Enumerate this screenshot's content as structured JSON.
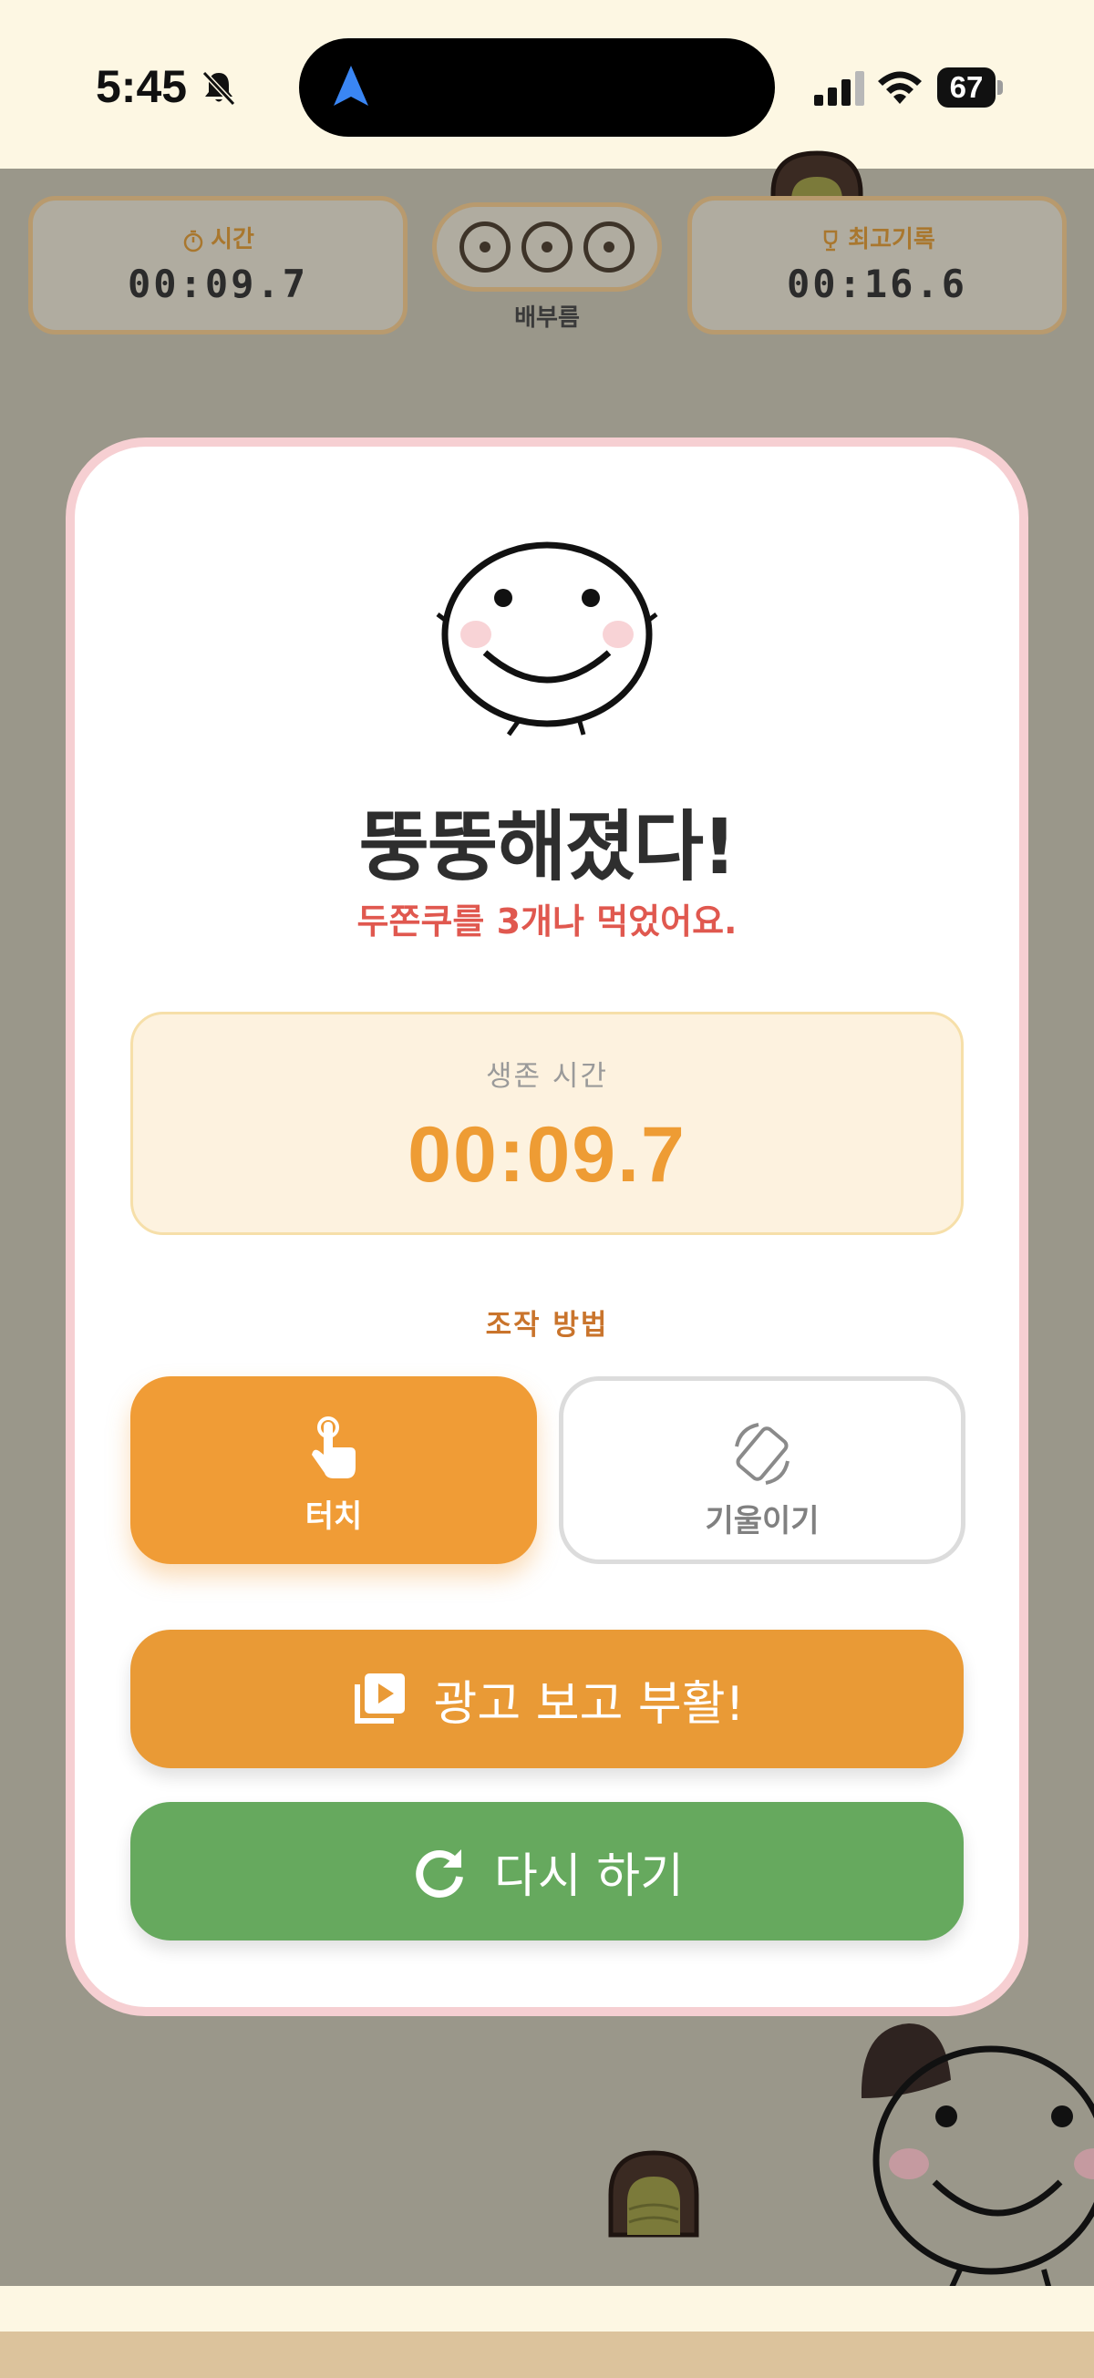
{
  "status_bar": {
    "time": "5:45",
    "battery": "67",
    "icons": [
      "bell-slash-icon",
      "location-arrow-icon",
      "signal-icon",
      "wifi-icon",
      "battery-icon"
    ]
  },
  "hud": {
    "time_label": "시간",
    "time_value": "00:09.7",
    "belly_label": "배부름",
    "belly_slots": 3,
    "best_label": "최고기록",
    "best_value": "00:16.6"
  },
  "result": {
    "title": "뚱뚱해졌다!",
    "subtitle": "두쫀쿠를 3개나 먹었어요.",
    "survival_label": "생존 시간",
    "survival_value": "00:09.7",
    "controls_label": "조작 방법",
    "control_touch_label": "터치",
    "control_tilt_label": "기울이기",
    "selected_control": "터치",
    "revive_button": "광고 보고 부활!",
    "retry_button": "다시 하기"
  },
  "colors": {
    "accent_orange": "#f09c36",
    "retry_green": "#66a95e",
    "subtitle_red": "#e0584f",
    "card_border": "#f6cfd2",
    "overlay": "#9a978a"
  }
}
